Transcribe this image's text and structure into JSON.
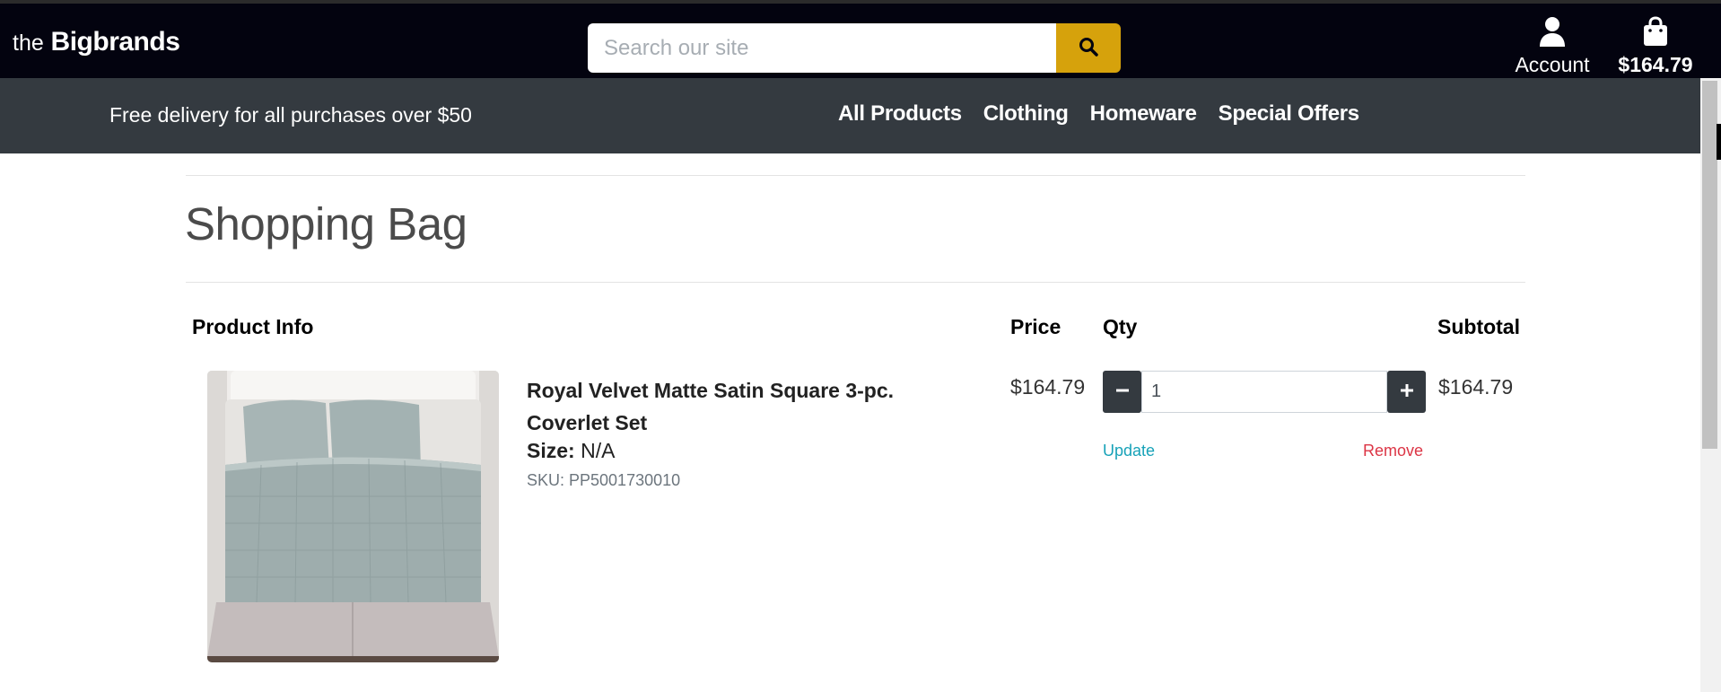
{
  "header": {
    "logo_prefix": "the",
    "logo_brand": "Bigbrands",
    "search_placeholder": "Search our site",
    "account_label": "Account",
    "bag_total": "$164.79"
  },
  "subbar": {
    "delivery_text": "Free delivery for all purchases over $50",
    "nav": [
      "All Products",
      "Clothing",
      "Homeware",
      "Special Offers"
    ]
  },
  "page": {
    "title": "Shopping Bag"
  },
  "table": {
    "headers": {
      "product_info": "Product Info",
      "price": "Price",
      "qty": "Qty",
      "subtotal": "Subtotal"
    },
    "item": {
      "name": "Royal Velvet Matte Satin Square 3-pc. Coverlet Set",
      "size_label": "Size:",
      "size_value": "N/A",
      "sku": "SKU: PP5001730010",
      "price": "$164.79",
      "qty": "1",
      "update_label": "Update",
      "remove_label": "Remove",
      "subtotal": "$164.79"
    }
  },
  "colors": {
    "header_bg": "#03030f",
    "subbar_bg": "#343a40",
    "search_button": "#d6a20c",
    "update_link": "#17a2b8",
    "remove_link": "#dc3545"
  },
  "icons": {
    "search": "search-icon",
    "account": "user-icon",
    "bag": "shopping-bag-icon",
    "minus": "minus-icon",
    "plus": "plus-icon"
  }
}
